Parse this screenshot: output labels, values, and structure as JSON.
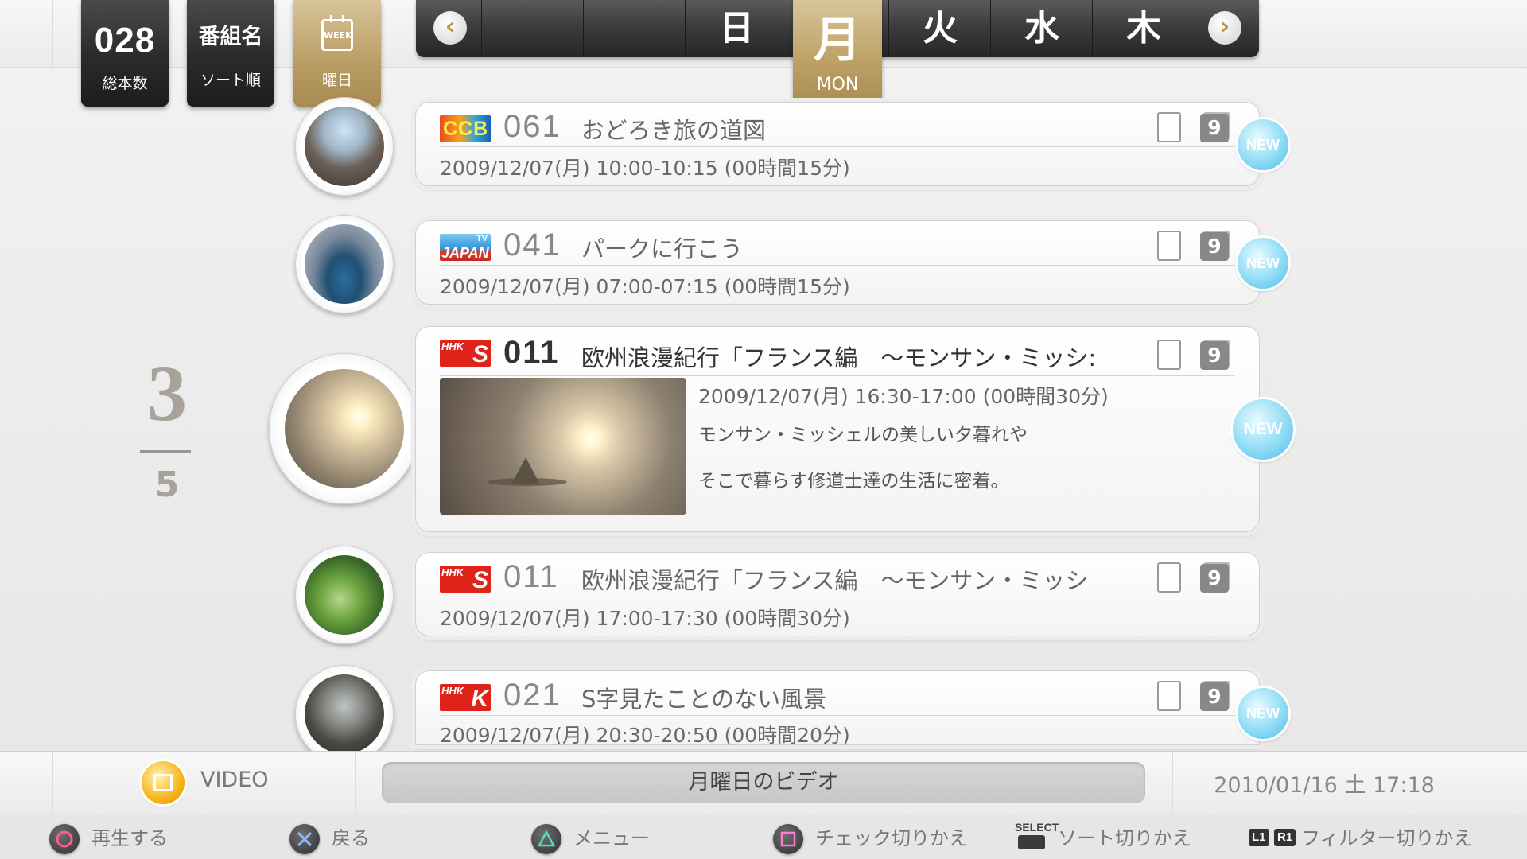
{
  "header": {
    "total": {
      "value": "028",
      "label": "総本数"
    },
    "sort": {
      "value": "番組名",
      "label": "ソート順"
    },
    "filter": {
      "icon_text": "WEEK",
      "label": "曜日",
      "icon": "calendar-icon"
    },
    "days": {
      "prev_arrow": "‹",
      "next_arrow": "›",
      "items": [
        "",
        "",
        "日",
        "火",
        "水",
        "木"
      ],
      "selected": {
        "kanji": "月",
        "english": "MON"
      }
    }
  },
  "pagination": {
    "current": "3",
    "total": "5"
  },
  "programs": [
    {
      "logo": "CCB",
      "channel": "061",
      "title": "おどろき旅の道図",
      "datetime": "2009/12/07(月) 10:00-10:15 (00時間15分)",
      "new": "NEW"
    },
    {
      "logo": "JAPAN",
      "logo_sup": "TV",
      "channel": "041",
      "title": "パークに行こう",
      "datetime": "2009/12/07(月) 07:00-07:15 (00時間15分)",
      "new": "NEW"
    },
    {
      "logo": "HHK",
      "logo_sub": "S",
      "channel": "011",
      "title": "欧州浪漫紀行「フランス編　～モンサン・ミッシ:",
      "datetime": "2009/12/07(月) 16:30-17:00 (00時間30分)",
      "description": [
        "モンサン・ミッシェルの美しい夕暮れや",
        "そこで暮らす修道士達の生活に密着。"
      ],
      "new": "NEW"
    },
    {
      "logo": "HHK",
      "logo_sub": "S",
      "channel": "011",
      "title": "欧州浪漫紀行「フランス編　～モンサン・ミッシ",
      "datetime": "2009/12/07(月) 17:00-17:30 (00時間30分)"
    },
    {
      "logo": "HHK",
      "logo_sub": "K",
      "channel": "021",
      "title": "S字見たことのない風景",
      "datetime": "2009/12/07(月) 20:30-20:50 (00時間20分)",
      "new": "NEW"
    }
  ],
  "row_icons": {
    "pc_glyph": "9"
  },
  "footer": {
    "app_label": "VIDEO",
    "title": "月曜日のビデオ",
    "clock": "2010/01/16 土 17:18"
  },
  "hints": {
    "circle": "再生する",
    "cross": "戻る",
    "triangle": "メニュー",
    "square": "チェック切りかえ",
    "select_label": "SELECT",
    "select": "ソート切りかえ",
    "l1": "L1",
    "r1": "R1",
    "lr": "フィルター切りかえ"
  },
  "colors": {
    "gold": "#bda166",
    "new_badge": "#8fdcf5",
    "dark_tile": "#2a2a2a"
  }
}
